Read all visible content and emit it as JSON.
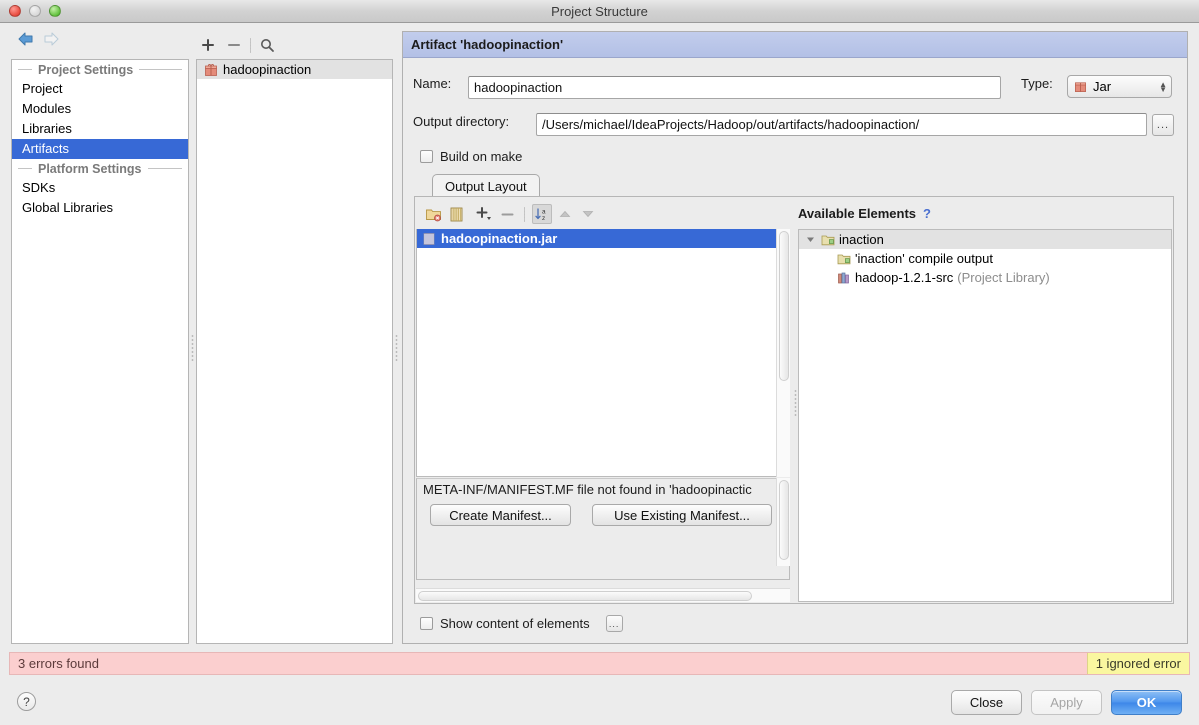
{
  "window": {
    "title": "Project Structure",
    "controls": [
      "close",
      "minimize",
      "zoom"
    ]
  },
  "nav": {
    "back_icon": "arrow-left-icon",
    "forward_icon": "arrow-right-icon"
  },
  "sidebar": {
    "sections": [
      {
        "title": "Project Settings",
        "items": [
          {
            "label": "Project",
            "selected": false
          },
          {
            "label": "Modules",
            "selected": false
          },
          {
            "label": "Libraries",
            "selected": false
          },
          {
            "label": "Artifacts",
            "selected": true
          }
        ]
      },
      {
        "title": "Platform Settings",
        "items": [
          {
            "label": "SDKs",
            "selected": false
          },
          {
            "label": "Global Libraries",
            "selected": false
          }
        ]
      }
    ]
  },
  "midpane": {
    "toolbar": [
      {
        "name": "add-artifact-button",
        "glyph": "+"
      },
      {
        "name": "remove-artifact-button",
        "glyph": "−"
      },
      {
        "name": "find-artifact-button",
        "glyph": "search"
      }
    ],
    "items": [
      {
        "label": "hadoopinaction",
        "icon": "jar-artifact-icon",
        "selected": true
      }
    ]
  },
  "detail": {
    "header": "Artifact 'hadoopinaction'",
    "name_label": "Name:",
    "name_value": "hadoopinaction",
    "type_label": "Type:",
    "type_value": "Jar",
    "output_dir_label": "Output directory:",
    "output_dir_value": "/Users/michael/IdeaProjects/Hadoop/out/artifacts/hadoopinaction/",
    "browse_button": "...",
    "build_on_make_label": "Build on make",
    "build_on_make_checked": false,
    "tabs": [
      {
        "label": "Output Layout",
        "active": true
      }
    ],
    "output_layout": {
      "toolbar": [
        {
          "name": "add-directory-button",
          "icon": "folder-remove-icon",
          "pressed": false
        },
        {
          "name": "add-archive-button",
          "icon": "archive-icon",
          "pressed": false
        },
        {
          "name": "add-element-button",
          "icon": "plus-dropdown-icon",
          "pressed": false
        },
        {
          "name": "remove-element-button",
          "icon": "minus-icon",
          "pressed": false
        },
        {
          "name": "sort-button",
          "icon": "sort-az-icon",
          "pressed": true
        },
        {
          "name": "move-up-button",
          "icon": "triangle-up-icon",
          "pressed": false
        },
        {
          "name": "move-down-button",
          "icon": "triangle-down-icon",
          "pressed": false
        }
      ],
      "tree": [
        {
          "label": "hadoopinaction.jar",
          "icon": "jar-icon",
          "selected": true,
          "indent": 0
        }
      ],
      "manifest_message": "META-INF/MANIFEST.MF file not found in 'hadoopinactic",
      "create_manifest_button": "Create Manifest...",
      "use_existing_manifest_button": "Use Existing Manifest..."
    },
    "available_elements": {
      "title": "Available Elements",
      "help_glyph": "?",
      "tree": [
        {
          "label": "inaction",
          "icon": "module-folder-icon",
          "indent": 0,
          "expanded": true,
          "header": true,
          "note": ""
        },
        {
          "label": "'inaction' compile output",
          "icon": "compile-output-icon",
          "indent": 1,
          "expanded": null,
          "header": false,
          "note": ""
        },
        {
          "label": "hadoop-1.2.1-src",
          "icon": "library-icon",
          "indent": 1,
          "expanded": null,
          "header": false,
          "note": "(Project Library)"
        }
      ]
    },
    "show_content_label": "Show content of elements",
    "show_content_checked": false,
    "show_content_options_button": "..."
  },
  "status": {
    "error_text": "3 errors found",
    "ignored_text": "1 ignored error",
    "error_bg": "#fbcfcf",
    "ignored_bg": "#faf7a0"
  },
  "footer": {
    "help_glyph": "?",
    "buttons": [
      {
        "label": "Close",
        "state": "normal"
      },
      {
        "label": "Apply",
        "state": "disabled"
      },
      {
        "label": "OK",
        "state": "primary"
      }
    ]
  }
}
